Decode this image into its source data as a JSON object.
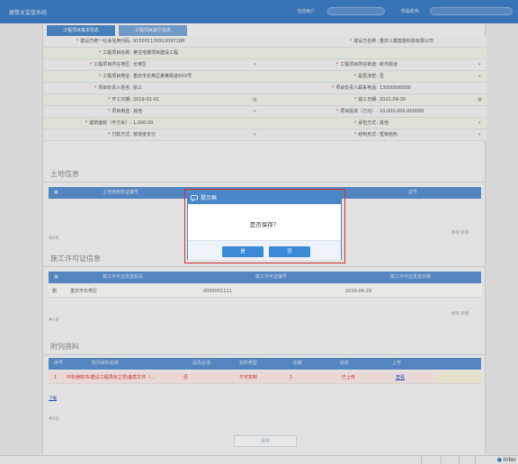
{
  "topbar": {
    "system_name": "建筑业监管系统",
    "user_label_1": "当前用户",
    "user_label_2": "所属机构"
  },
  "tabs": [
    "工程项目基本信息",
    "工程项目其它信息"
  ],
  "form_rows": [
    {
      "l1": "建设方统一社会信用代码",
      "v1": "91500113691209718R",
      "l2": "建设方名称",
      "v2": "重庆三鑫智能科技有限公司"
    },
    {
      "l1": "工程项目名称",
      "v1": "某住宅楼项目建设工程",
      "l2": "",
      "v2": ""
    },
    {
      "l1": "工程项目所在地区",
      "v1": "长寿区",
      "l2": "工程项目所在街道",
      "v2": "新市街道"
    },
    {
      "l1": "工程项目地址",
      "v1": "重庆市长寿区某某街道XXX号",
      "l2": "是否涉密",
      "v2": "否"
    },
    {
      "l1": "项目负责人姓名",
      "v1": "张三",
      "l2": "项目负责人联系电话",
      "v2": "13000000000"
    },
    {
      "l1": "开工日期",
      "v1": "2019-01-01",
      "l2": "竣工日期",
      "v2": "2021-09-30"
    },
    {
      "l1": "项目用途",
      "v1": "其他",
      "l2": "项目投资（万元）",
      "v2": "10,000,000.000000"
    },
    {
      "l1": "建筑面积（平方米）",
      "v1": "1,000.00",
      "l2": "承包方式",
      "v2": "其他"
    },
    {
      "l1": "付款方式",
      "v1": "按进度支付",
      "l2": "结构形式",
      "v2": "框架结构"
    }
  ],
  "land": {
    "title": "土地信息",
    "col_left": "土地使用权证编号",
    "col_right": "证号",
    "count": "共0条",
    "actions": "保存 新增"
  },
  "permit": {
    "title": "施工许可证信息",
    "cols": [
      "施工许可证发放机关",
      "施工许可证编号",
      "施工许可证发放日期"
    ],
    "row": {
      "region": "重庆市长寿区",
      "number": "0000001111",
      "date": "2019-09-29",
      "action": "删"
    },
    "count": "共1条",
    "actions": "保存 新增"
  },
  "attachments": {
    "title": "附列资料",
    "cols": [
      "序号",
      "附列资料名称",
      "是否必须",
      "资料类型",
      "份数",
      "状态",
      "上传"
    ],
    "row": {
      "idx": "1",
      "name": "中标通知书/建设工程项目立项/备案文件（...",
      "required": "否",
      "type": "不可复制",
      "copies": "1",
      "status": "已上传",
      "upload": "查看"
    },
    "download": "下载",
    "count": "共1条"
  },
  "save_button": "保存",
  "dialog": {
    "title": "提示框",
    "message": "是否保存？",
    "ok": "是",
    "cancel": "否"
  },
  "statusbar": {
    "zone": "Inter"
  }
}
